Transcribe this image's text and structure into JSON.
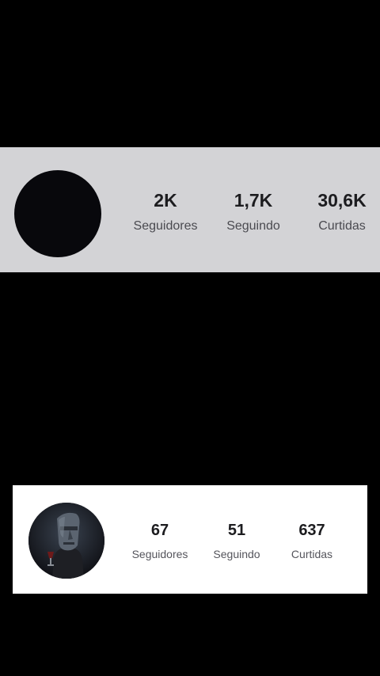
{
  "profile_top": {
    "stats": [
      {
        "value": "2K",
        "label": "Seguidores"
      },
      {
        "value": "1,7K",
        "label": "Seguindo"
      },
      {
        "value": "30,6K",
        "label": "Curtidas"
      }
    ],
    "colors": {
      "card_bg": "#d3d3d6",
      "avatar": "#08080c"
    }
  },
  "profile_bottom": {
    "stats": [
      {
        "value": "67",
        "label": "Seguidores"
      },
      {
        "value": "51",
        "label": "Seguindo"
      },
      {
        "value": "637",
        "label": "Curtidas"
      }
    ],
    "colors": {
      "card_bg": "#ffffff",
      "avatar": "#14151c"
    }
  },
  "colors": {
    "background": "#000000"
  }
}
